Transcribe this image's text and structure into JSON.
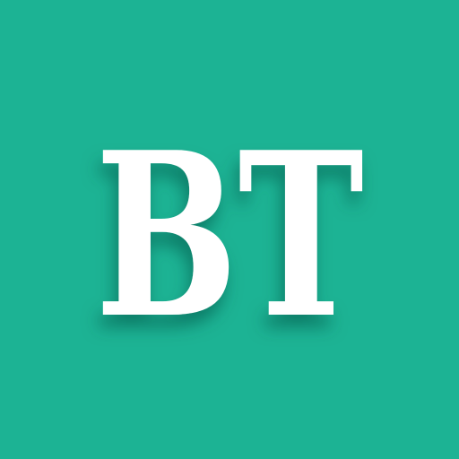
{
  "icon": {
    "monogram": "BT",
    "background_color": "#1cb394",
    "letter_color": "#ffffff",
    "shadow_color": "#0a5245"
  }
}
